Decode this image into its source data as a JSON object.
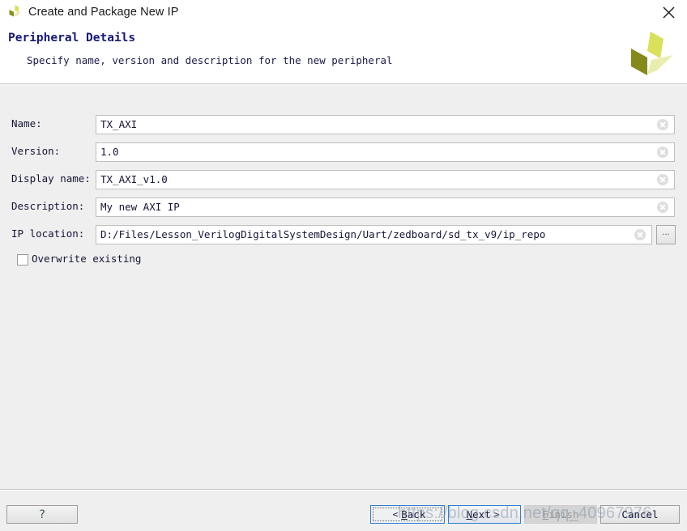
{
  "window": {
    "title": "Create and Package New IP",
    "app_icon": "xilinx-logo-icon",
    "close_icon": "close-icon"
  },
  "header": {
    "title": "Peripheral Details",
    "subtitle": "Specify name, version and description for the new peripheral",
    "brand_logo": "xilinx-pinwheel-logo"
  },
  "form": {
    "fields": [
      {
        "label": "Name:",
        "value": "TX_AXI",
        "name": "name"
      },
      {
        "label": "Version:",
        "value": "1.0",
        "name": "version"
      },
      {
        "label": "Display name:",
        "value": "TX_AXI_v1.0",
        "name": "display-name"
      },
      {
        "label": "Description:",
        "value": "My new AXI IP",
        "name": "description"
      },
      {
        "label": "IP location:",
        "value": "D:/Files/Lesson_VerilogDigitalSystemDesign/Uart/zedboard/sd_tx_v9/ip_repo",
        "name": "ip-location"
      }
    ],
    "clear_icon": "clear-circle-icon",
    "browse_label": "...",
    "overwrite": {
      "label": "Overwrite existing",
      "checked": false
    }
  },
  "footer": {
    "help_label": "?",
    "back_label": "Back",
    "back_chevron": "<",
    "next_label": "Next",
    "next_chevron": ">",
    "finish_label": "Finish",
    "cancel_label": "Cancel"
  },
  "watermark": {
    "text": "https://blog.csdn.net/qq_40967976"
  },
  "colors": {
    "background": "#efefef",
    "titlebar": "#ffffff",
    "label_text": "#151538",
    "header_title": "#16187a",
    "focus_border": "#2d7fd6",
    "logo_dark": "#84891a",
    "logo_mid": "#d9e05a",
    "logo_light": "#e9eeb0"
  }
}
